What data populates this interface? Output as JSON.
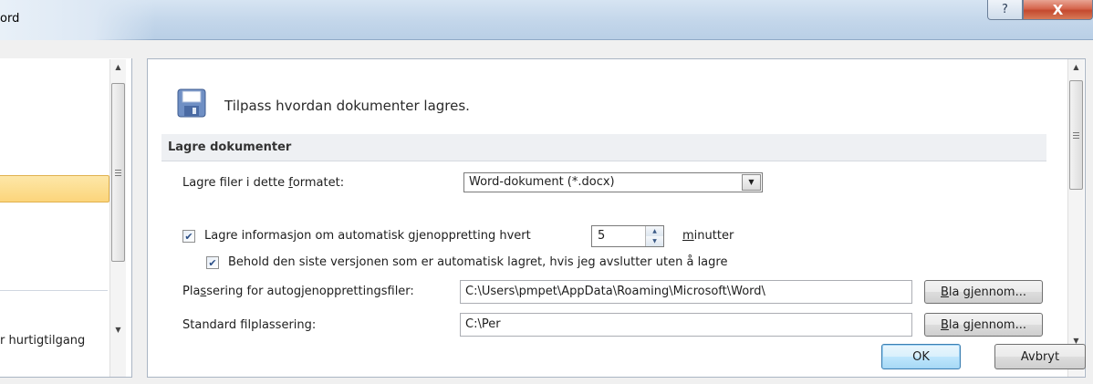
{
  "window": {
    "title": "ord",
    "help_glyph": "?",
    "close_glyph": "X"
  },
  "nav": {
    "bottom_item": "r hurtigtilgang",
    "selected_item": ""
  },
  "main": {
    "intro": "Tilpass hvordan dokumenter lagres.",
    "section_title": "Lagre dokumenter",
    "format": {
      "label_before": "Lagre filer i dette ",
      "label_accel": "f",
      "label_after": "ormatet:",
      "value": "Word-dokument (*.docx)"
    },
    "autorecover": {
      "checked": true,
      "label_before": "Lagre informasjon om automatisk ",
      "label_accel": "g",
      "label_after": "jenoppretting hvert",
      "minutes_value": "5",
      "unit_accel": "m",
      "unit_after": "inutter"
    },
    "keep_last": {
      "checked": true,
      "label": "Behold den siste versjonen som er automatisk lagret, hvis jeg avslutter uten å lagre"
    },
    "autorecover_location": {
      "label_before": "Pla",
      "label_accel": "s",
      "label_after": "sering for autogjenopprettingsfiler:",
      "value": "C:\\Users\\pmpet\\AppData\\Roaming\\Microsoft\\Word\\",
      "browse_accel": "B",
      "browse_after": "la gjennom..."
    },
    "default_location": {
      "label_before": "Standard f",
      "label_accel": "i",
      "label_after": "lplassering:",
      "value": "C:\\Per",
      "browse_accel": "B",
      "browse_after": "la gjennom..."
    }
  },
  "footer": {
    "ok_label": "OK",
    "cancel_label": "Avbryt"
  },
  "colors": {
    "title_gradient": "#c3d6ea",
    "selection": "#fcd57b",
    "ok_accent": "#3c7fb1",
    "close_red": "#c44a2f"
  }
}
